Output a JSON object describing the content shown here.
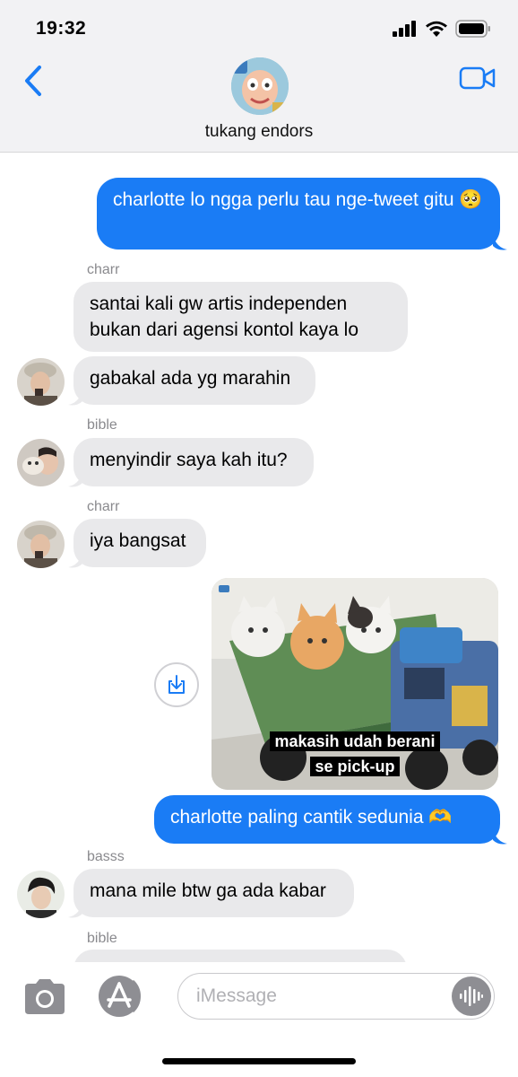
{
  "status_bar": {
    "time": "19:32"
  },
  "header": {
    "title": "tukang endors"
  },
  "messages": [
    {
      "sender": "",
      "text": "charlotte lo ngga perlu tau nge-tweet gitu 🥺"
    },
    {
      "sender": "charr",
      "text": "santai kali gw artis independen bukan dari agensi kontol kaya lo"
    },
    {
      "sender": "",
      "text": "gabakal ada yg marahin"
    },
    {
      "sender": "bible",
      "text": "menyindir saya kah itu?"
    },
    {
      "sender": "charr",
      "text": "iya bangsat"
    },
    {
      "image_caption_1": "makasih udah berani",
      "image_caption_2": "se pick-up"
    },
    {
      "sender": "",
      "text": "charlotte paling cantik sedunia 🫶"
    },
    {
      "sender": "basss",
      "text": "mana mile btw ga ada kabar"
    },
    {
      "sender": "bible",
      "text": ""
    }
  ],
  "composer": {
    "placeholder": "iMessage"
  },
  "colors": {
    "outgoing": "#1a7cf5",
    "incoming": "#e9e9eb",
    "accent": "#1a7cf5"
  }
}
